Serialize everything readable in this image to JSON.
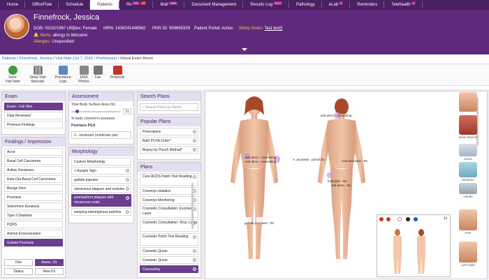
{
  "nav": {
    "tabs": [
      {
        "label": "Home"
      },
      {
        "label": "OfficeFlow"
      },
      {
        "label": "Schedule"
      },
      {
        "label": "Patients"
      },
      {
        "label": "Rx",
        "badge1": "203",
        "badge2": "13"
      },
      {
        "label": "Mail",
        "badge1": "2453"
      },
      {
        "label": "Document Management"
      },
      {
        "label": "Results Log",
        "badge1": "3023"
      },
      {
        "label": "Pathology"
      },
      {
        "label": "eLab",
        "badge1": "2"
      },
      {
        "label": "Reminders"
      },
      {
        "label": "Telehealth",
        "badge1": "3"
      }
    ]
  },
  "patient": {
    "name": "Finnefrock, Jessica",
    "dob_label": "DOB:",
    "dob": "02/10/1967 (49)",
    "sex_label": "Sex:",
    "sex": "Female",
    "mrn_label": "MRN:",
    "mrn": "1438241446562",
    "pms_label": "PMS ID:",
    "pms": "959665339",
    "portal_label": "Patient Portal:",
    "portal": "Active",
    "sticky_label": "Sticky Notes:",
    "sticky": "Test test3",
    "alerts_label": "Alerts:",
    "alerts": "allergy to lidocaine",
    "allergies_label": "Allergies:",
    "allergies": "Unspecified"
  },
  "breadcrumb": {
    "items": [
      "Patients",
      "Finnefrock, Jessica",
      "Visit Note (Jul 7, 2016 • Preliminary)"
    ],
    "current": "Virtual Exam Room"
  },
  "toolbar": {
    "buttons": [
      {
        "line1": "Save",
        "line2": "Visit Note"
      },
      {
        "line1": "Show Visit",
        "line2": "Barcode"
      },
      {
        "line1": "Procedure",
        "line2": "Logs"
      },
      {
        "line1": "EMA",
        "line2": "Photos"
      },
      {
        "line1": "Fax",
        "line2": ""
      },
      {
        "line1": "Protocols",
        "line2": ""
      }
    ]
  },
  "exam": {
    "title": "Exam",
    "items": [
      "Exam - Full Skin",
      "Data Reviewed",
      "Previous Findings"
    ]
  },
  "findings": {
    "title": "Findings / Impression",
    "items": [
      "Acne",
      "Basal Cell Carcinoma",
      "Actinic Keratoses",
      "Rule-Out Basal Cell Carcinoma",
      "Benign Nevi",
      "Psoriasis",
      "Seborrheic Keratosis",
      "Type II Diabetes",
      "PQRS",
      "Animal Envenomation",
      "Guttate Psoriasis"
    ],
    "buttons": [
      "Ddx",
      "Assoc. Dx",
      "Status",
      "New Dx"
    ]
  },
  "assessment": {
    "title": "Assessment",
    "bsa_label": "Total Body Surface Area (%)",
    "bsa_value": "11",
    "bsa_caption": "% body covered in psoriasis",
    "pga_label": "Psoriasis PGA",
    "pga_value": "3 - moderate (moderate plac"
  },
  "morphology": {
    "title": "Morphology",
    "items": [
      "Custom Morphology",
      "+ Auspitz Sign",
      "guttate papules",
      "ostraceous plaques and nodules",
      "psoriasiform plaques with micaceous scale",
      "weeping intertriginous patches"
    ]
  },
  "search_plans": {
    "title": "Search Plans",
    "placeholder": "Search Plans by Name"
  },
  "popular_plans": {
    "title": "Popular Plans",
    "items": [
      "Prescription",
      "Bath PUVA Order*",
      "Biopsy by Punch Method*"
    ]
  },
  "plans": {
    "title": "Plans",
    "items": [
      "Core ACDS Patch Test Reading",
      "Cosentyx Initiation",
      "Cosentyx Monitoring",
      "Cosmetic Consultation: Excimer Laser",
      "Cosmetic Consultation: Xtrac Laser",
      "Cosmetic Patch Test Reading",
      "Cosmetic Quote",
      "Cosmetic Quote",
      "Counseling"
    ]
  },
  "body_labels": {
    "front_forearm": "seb derm - counseling",
    "front_forearm2": "seb derm - counseling",
    "front_leg": "guttate psoriasis - Rx",
    "back_head": "seb derm - counseling",
    "back_left_arm": "A. psoriasis - punch bx",
    "back_right_arm": "core psoriasis - Rx",
    "back_buttock": "folliculitis - Rx",
    "back_buttock2": "seb derm - Rx"
  },
  "minimap": {
    "zoom": "1x"
  },
  "regions": {
    "items": [
      "Deep Muscle",
      "Joints",
      "Skeleton",
      "Hands",
      "Feet",
      "Left Axilla"
    ]
  }
}
